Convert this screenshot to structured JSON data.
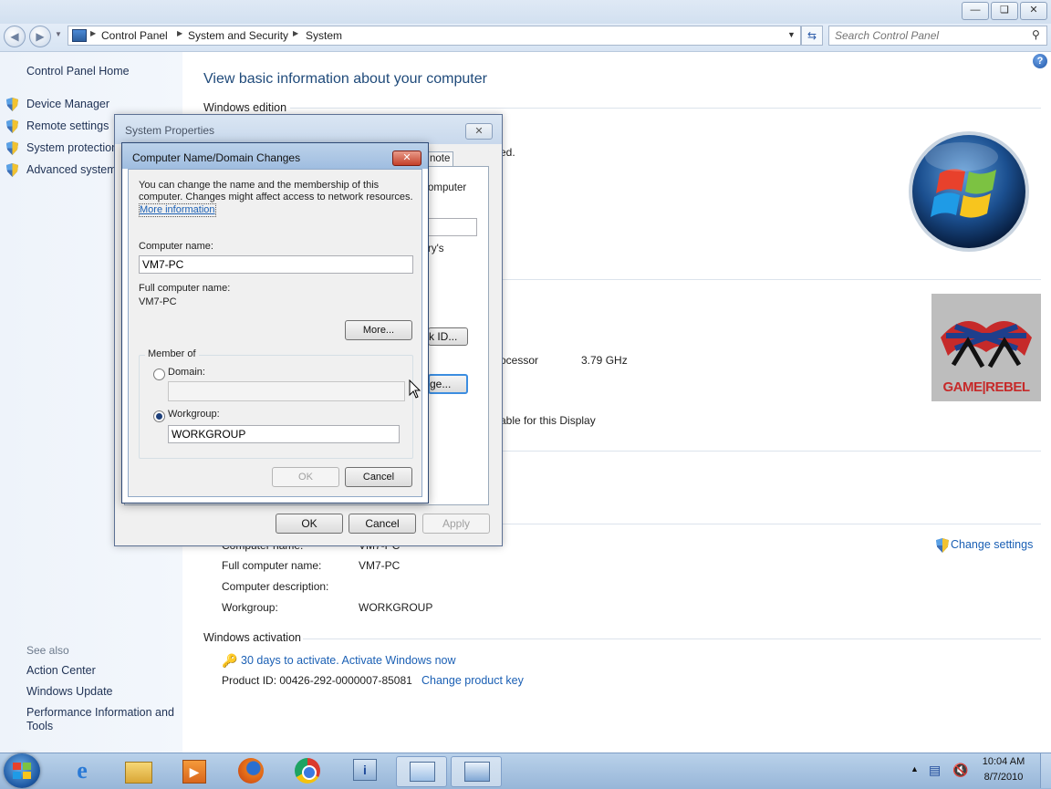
{
  "address": {
    "crumbs": [
      "Control Panel",
      "System and Security",
      "System"
    ],
    "search_placeholder": "Search Control Panel"
  },
  "sidebar": {
    "home": "Control Panel Home",
    "items": [
      "Device Manager",
      "Remote settings",
      "System protection",
      "Advanced system"
    ],
    "see_also_title": "See also",
    "see_also": [
      "Action Center",
      "Windows Update",
      "Performance Information and",
      "Tools"
    ]
  },
  "main": {
    "title": "View basic information about your computer",
    "windows_edition": "Windows edition",
    "frag_ed": "ed.",
    "frag_omputer": "omputer",
    "frag_rys": "ry's",
    "frag_kid": "k ID...",
    "frag_ge": "ge...",
    "frag_processor": "ocessor",
    "processor_speed": "3.79 GHz",
    "frag_display": "able for this Display",
    "computer_name_label": "Computer name:",
    "computer_name_value": "VM7-PC",
    "full_name_label": "Full computer name:",
    "full_name_value": "VM7-PC",
    "description_label": "Computer description:",
    "workgroup_label": "Workgroup:",
    "workgroup_value": "WORKGROUP",
    "change_settings": "Change settings",
    "activation_header": "Windows activation",
    "activation_link": "30 days to activate. Activate Windows now",
    "product_id": "Product ID: 00426-292-0000007-85081",
    "change_key": "Change product key",
    "brand_logo_text": "GAME|REBEL"
  },
  "sysprops": {
    "title": "System Properties",
    "tab_fragment": "note",
    "ok": "OK",
    "cancel": "Cancel",
    "apply": "Apply"
  },
  "cn_dialog": {
    "title": "Computer Name/Domain Changes",
    "intro_1": "You can change the name and the membership of this",
    "intro_2": "computer. Changes might affect access to network resources.",
    "more_info": "More information",
    "computer_name_label": "Computer name:",
    "computer_name_value": "VM7-PC",
    "full_name_label": "Full computer name:",
    "full_name_value": "VM7-PC",
    "more_button": "More...",
    "member_of": "Member of",
    "domain_label": "Domain:",
    "domain_value": "",
    "workgroup_label": "Workgroup:",
    "workgroup_value": "WORKGROUP",
    "ok": "OK",
    "cancel": "Cancel",
    "selected": "workgroup"
  },
  "taskbar": {
    "time": "10:04 AM",
    "date": "8/7/2010"
  },
  "colors": {
    "link": "#1a5fb4",
    "title_blue": "#1f4a7a",
    "taskbar": "#a9c4e2"
  }
}
